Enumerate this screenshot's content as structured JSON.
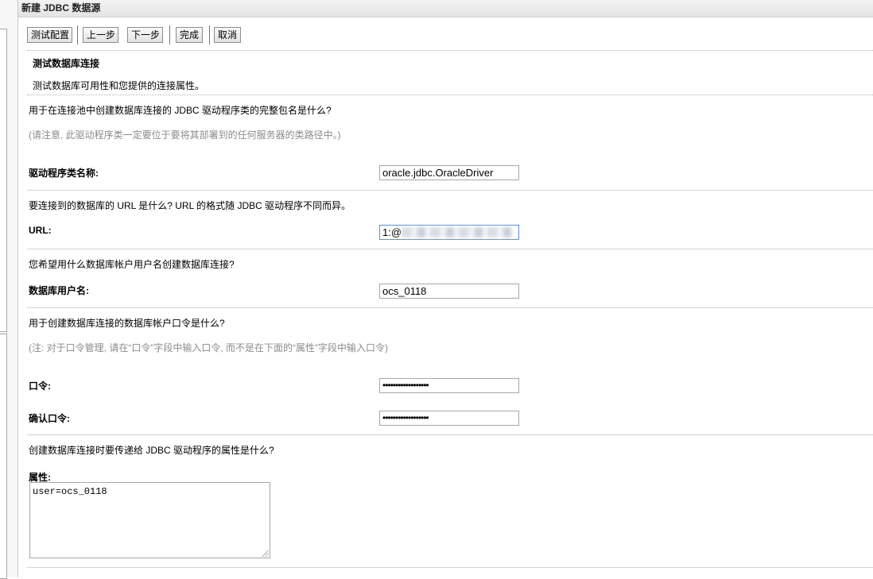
{
  "window": {
    "title": "新建 JDBC 数据源"
  },
  "toolbar": {
    "test_config": "测试配置",
    "back": "上一步",
    "next": "下一步",
    "finish": "完成",
    "cancel": "取消"
  },
  "section": {
    "heading": "测试数据库连接",
    "description": "测试数据库可用性和您提供的连接属性。"
  },
  "driver": {
    "question": "用于在连接池中创建数据库连接的 JDBC 驱动程序类的完整包名是什么?",
    "note": "(请注意, 此驱动程序类一定要位于要将其部署到的任何服务器的类路径中。)",
    "label": "驱动程序类名称:",
    "value": "oracle.jdbc.OracleDriver"
  },
  "url": {
    "question": "要连接到的数据库的 URL 是什么? URL 的格式随 JDBC 驱动程序不同而异。",
    "label": "URL:",
    "value_visible": "1:@"
  },
  "user": {
    "question": "您希望用什么数据库帐户用户名创建数据库连接?",
    "label": "数据库用户名:",
    "value": "ocs_0118"
  },
  "password": {
    "question": "用于创建数据库连接的数据库帐户口令是什么?",
    "note": "(注: 对于口令管理, 请在“口令”字段中输入口令, 而不是在下面的“属性”字段中输入口令)",
    "label": "口令:",
    "mask": "••••••••••••••••••",
    "confirm_label": "确认口令:",
    "confirm_mask": "••••••••••••••••••"
  },
  "properties": {
    "question": "创建数据库连接时要传递给 JDBC 驱动程序的属性是什么?",
    "label": "属性:",
    "value": "user=ocs_0118"
  },
  "colors": {
    "focus_border": "#5b8fd6",
    "muted_text": "#8b8b8b"
  }
}
